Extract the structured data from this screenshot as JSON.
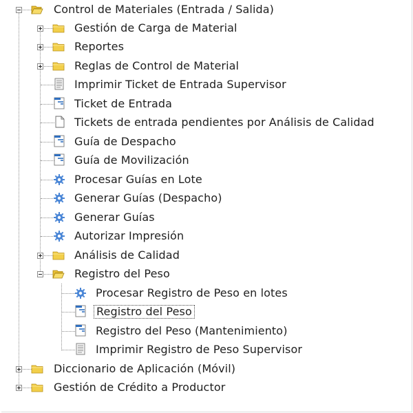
{
  "tree": {
    "nodes": [
      {
        "id": "control-materiales",
        "label": "Control de Materiales (Entrada / Salida)",
        "icon": "folder-open-icon",
        "toggle": "minus"
      },
      {
        "id": "gestion-carga",
        "label": "Gestión de Carga de Material",
        "icon": "folder-icon",
        "toggle": "plus"
      },
      {
        "id": "reportes",
        "label": "Reportes",
        "icon": "folder-icon",
        "toggle": "plus"
      },
      {
        "id": "reglas-control",
        "label": "Reglas de Control de Material",
        "icon": "folder-icon",
        "toggle": "plus"
      },
      {
        "id": "imprimir-ticket",
        "label": "Imprimir Ticket de Entrada Supervisor",
        "icon": "report-document-icon",
        "toggle": ""
      },
      {
        "id": "ticket-entrada",
        "label": "Ticket de Entrada",
        "icon": "form-window-icon",
        "toggle": ""
      },
      {
        "id": "tickets-pendientes",
        "label": "Tickets de entrada pendientes por Análisis de Calidad",
        "icon": "blank-document-icon",
        "toggle": ""
      },
      {
        "id": "guia-despacho",
        "label": "Guía de Despacho",
        "icon": "form-window-icon",
        "toggle": ""
      },
      {
        "id": "guia-movilizacion",
        "label": "Guía de Movilización",
        "icon": "form-window-icon",
        "toggle": ""
      },
      {
        "id": "procesar-guias-lote",
        "label": "Procesar Guías en Lote",
        "icon": "gear-icon",
        "toggle": ""
      },
      {
        "id": "generar-guias-despacho",
        "label": "Generar Guías (Despacho)",
        "icon": "gear-icon",
        "toggle": ""
      },
      {
        "id": "generar-guias",
        "label": "Generar Guías",
        "icon": "gear-icon",
        "toggle": ""
      },
      {
        "id": "autorizar-impresion",
        "label": "Autorizar Impresión",
        "icon": "gear-icon",
        "toggle": ""
      },
      {
        "id": "analisis-calidad",
        "label": "Análisis de Calidad",
        "icon": "folder-icon",
        "toggle": "plus"
      },
      {
        "id": "registro-peso-folder",
        "label": "Registro del Peso",
        "icon": "folder-open-icon",
        "toggle": "minus"
      },
      {
        "id": "procesar-registro-lotes",
        "label": "Procesar Registro de Peso en lotes",
        "icon": "gear-icon",
        "toggle": ""
      },
      {
        "id": "registro-peso",
        "label": "Registro del Peso",
        "icon": "form-window-icon",
        "toggle": ""
      },
      {
        "id": "registro-peso-mant",
        "label": "Registro del Peso (Mantenimiento)",
        "icon": "form-window-icon",
        "toggle": ""
      },
      {
        "id": "imprimir-registro",
        "label": "Imprimir Registro de Peso Supervisor",
        "icon": "report-document-icon",
        "toggle": ""
      },
      {
        "id": "diccionario-app",
        "label": "Diccionario de Aplicación (Móvil)",
        "icon": "folder-icon",
        "toggle": "plus"
      },
      {
        "id": "gestion-credito",
        "label": "Gestión de Crédito a Productor",
        "icon": "folder-icon",
        "toggle": "plus"
      }
    ],
    "selected_id": "registro-peso"
  },
  "colors": {
    "folder_fill": "#f2cf4a",
    "folder_edge": "#b8901a",
    "gear": "#4a86d6",
    "form_blue": "#2f6fc0",
    "tree_line": "#8c8c8c"
  }
}
